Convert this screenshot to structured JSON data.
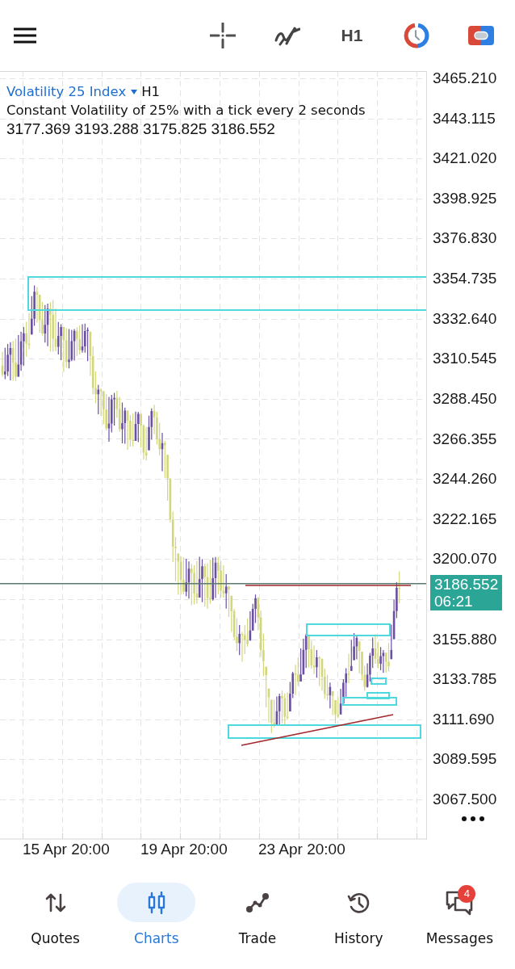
{
  "toolbar": {
    "timeframe": "H1"
  },
  "chart": {
    "symbol": "Volatility 25 Index",
    "timeframe": "H1",
    "description": "Constant Volatility of 25% with a tick every 2 seconds",
    "ohlc": "3177.369 3193.288 3175.825 3186.552",
    "price_labels": [
      "3465.210",
      "3443.115",
      "3421.020",
      "3398.925",
      "3376.830",
      "3354.735",
      "3332.640",
      "3310.545",
      "3288.450",
      "3266.355",
      "3244.260",
      "3222.165",
      "3200.070",
      "3155.880",
      "3133.785",
      "3111.690",
      "3089.595",
      "3067.500"
    ],
    "current_price": {
      "price": "3186.552",
      "countdown": "06:21"
    },
    "time_labels": [
      "15 Apr 20:00",
      "19 Apr 20:00",
      "23 Apr 20:00"
    ]
  },
  "tab_bar": [
    {
      "label": "Quotes",
      "selected": false
    },
    {
      "label": "Charts",
      "selected": true
    },
    {
      "label": "Trade",
      "selected": false
    },
    {
      "label": "History",
      "selected": false
    },
    {
      "label": "Messages",
      "selected": false,
      "badge": "4"
    }
  ]
}
